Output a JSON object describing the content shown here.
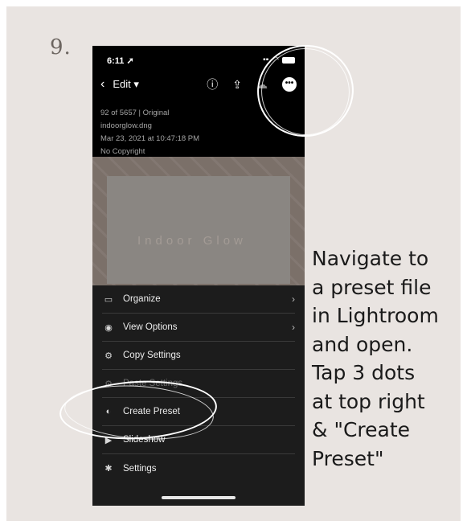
{
  "step_number": "9.",
  "phone": {
    "status": {
      "time": "6:11"
    },
    "nav": {
      "back_icon": "chevron-left-icon",
      "edit_label": "Edit ▾"
    },
    "meta": [
      "92 of 5657 | Original",
      "indoorglow.dng",
      "Mar 23, 2021 at 10:47:18 PM",
      "No Copyright"
    ],
    "photo_text": "Indoor Glow",
    "menu": [
      {
        "label": "Organize",
        "icon": "folder-icon",
        "chevron": "›"
      },
      {
        "label": "View Options",
        "icon": "view-options-icon",
        "chevron": "›"
      },
      {
        "label": "Copy Settings",
        "icon": "copy-settings-icon"
      },
      {
        "label": "Paste Settings",
        "icon": "paste-settings-icon",
        "disabled": true
      },
      {
        "label": "Create Preset",
        "icon": "create-preset-icon"
      },
      {
        "label": "Slideshow",
        "icon": "play-icon"
      },
      {
        "label": "Settings",
        "icon": "gear-icon"
      }
    ]
  },
  "instruction_lines": [
    "Navigate to",
    "a preset file",
    "in Lightroom",
    "and open.",
    "Tap 3 dots",
    "at top right",
    "& \"Create",
    "Preset\""
  ]
}
